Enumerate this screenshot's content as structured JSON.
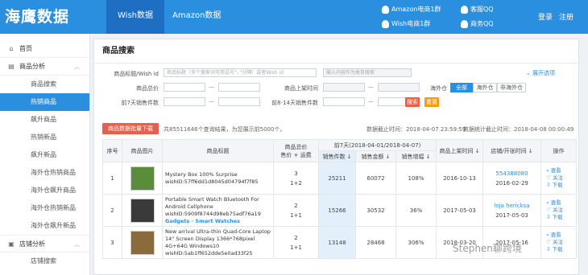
{
  "header": {
    "logo": "海鹰数据",
    "tabs": [
      "Wish数据",
      "Amazon数据"
    ],
    "qq_groups": [
      "Amazon电商1群",
      "Wish电商1群",
      "客服QQ",
      "商务QQ"
    ],
    "login": "登录",
    "register": "注册"
  },
  "sidebar": {
    "home": "首页",
    "group1": "商品分析",
    "items": [
      "商品搜索",
      "热销商品",
      "飙升商品",
      "热销新品",
      "飙升新品",
      "海外仓热销商品",
      "海外仓飙升商品",
      "海外仓热销新品",
      "海外仓飙升新品"
    ],
    "group2": "店铺分析",
    "group2_items": [
      "店铺搜索"
    ]
  },
  "panel": {
    "title": "商品搜索",
    "filters": {
      "title_label": "商品标题/Wish id",
      "title_placeholder": "商品标题（多个搜索词可用逗号“，”分隔）或者Wish id",
      "category_placeholder": "输入内容作为类目搜索",
      "expand": "展开选项",
      "price_label": "商品总价",
      "upload_label": "商品上架时间",
      "overseas_label": "海外仓",
      "overseas_opts": [
        "全部",
        "海外仓",
        "非海外仓"
      ],
      "sales7_label": "前7天销售件数",
      "sales8_14_label": "前8-14天销售件数",
      "search_btn": "搜索",
      "reset_btn": "重置",
      "dash": "—"
    },
    "export_btn": "商品数据批量下载",
    "result_info": "共85511646个查询结果，为您展示前5000个。",
    "data_until": "数据截止时间：2018-04-07 23:59:59",
    "stats_until": "数据统计截止时间：2018-04-08 00:00:49"
  },
  "table": {
    "headers": {
      "index": "序号",
      "image": "商品图片",
      "title": "商品标题",
      "price": "商品总价",
      "price_sub": "售价 + 运费",
      "week_group": "前7天(2018-04-01/2018-04-07)",
      "sales_qty": "销售件数 ↓",
      "sales_amt": "销售金额 ↓",
      "growth": "销售增幅 ↓",
      "upload": "商品上架时间 ↓",
      "shop": "店铺/开张时间 ↓",
      "action": "操作"
    },
    "rows": [
      {
        "index": "1",
        "title": "Mystery Box 100% Surprise",
        "wish_id": "wishID:57ff6dd1d8045d04794f7f85",
        "tag": "",
        "price": "3",
        "price_sub": "1+2",
        "sales_qty": "25211",
        "sales_amt": "60072",
        "growth": "108%",
        "upload": "2016-10-13",
        "shop": "554388080",
        "shop_date": "2016-02-29",
        "thumb_color": "#5b8c3a"
      },
      {
        "index": "2",
        "title": "Portable Smart Watch Bluetooth For Android Cellphone",
        "wish_id": "wishID:5909f8744d98eb75adf76a19",
        "tag": "Gadgets · Smart Watches",
        "price": "2",
        "price_sub": "1+1",
        "sales_qty": "15266",
        "sales_amt": "30532",
        "growth": "36%",
        "upload": "2017-05-03",
        "shop": "loja hericksa",
        "shop_date": "2017-05-03",
        "thumb_color": "#3a3a3a"
      },
      {
        "index": "3",
        "title": "New arrival Ultra-thin Quad-Core Laptop 14\" Screen Display 1366*768pixel 4G+64G Windows10",
        "wish_id": "wishID:5ab1ff652dde5e0ad33f25",
        "tag": "",
        "price": "2",
        "price_sub": "1+1",
        "sales_qty": "13148",
        "sales_amt": "28468",
        "growth": "306%",
        "upload": "2018-03-20",
        "shop": "",
        "shop_date": "2017-05-16",
        "thumb_color": "#8b6a3e"
      }
    ],
    "actions": [
      "查看",
      "关注",
      "下载"
    ]
  },
  "watermark": "Stephen聊跨境"
}
